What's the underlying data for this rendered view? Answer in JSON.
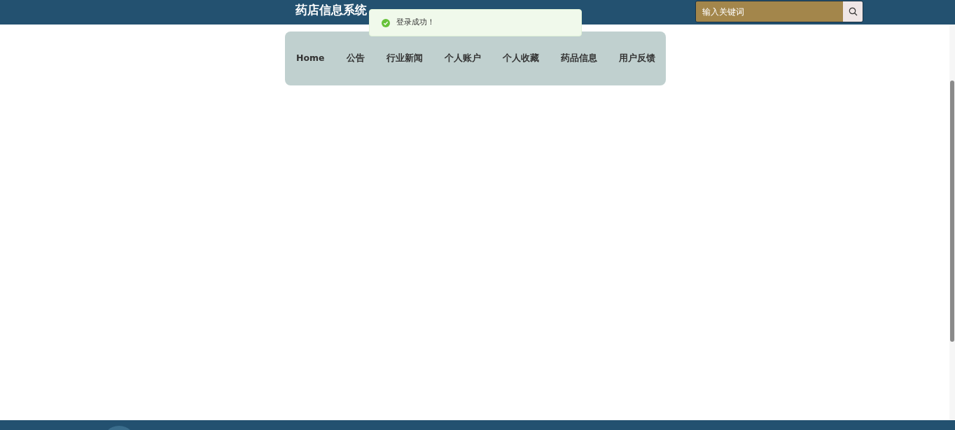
{
  "header": {
    "title": "药店信息系统",
    "search": {
      "placeholder": "输入关键词"
    }
  },
  "toast": {
    "kind": "success",
    "message": "登录成功！"
  },
  "nav": [
    {
      "label": "Home"
    },
    {
      "label": "公告"
    },
    {
      "label": "行业新闻"
    },
    {
      "label": "个人账户"
    },
    {
      "label": "个人收藏"
    },
    {
      "label": "药品信息"
    },
    {
      "label": "用户反馈"
    }
  ]
}
